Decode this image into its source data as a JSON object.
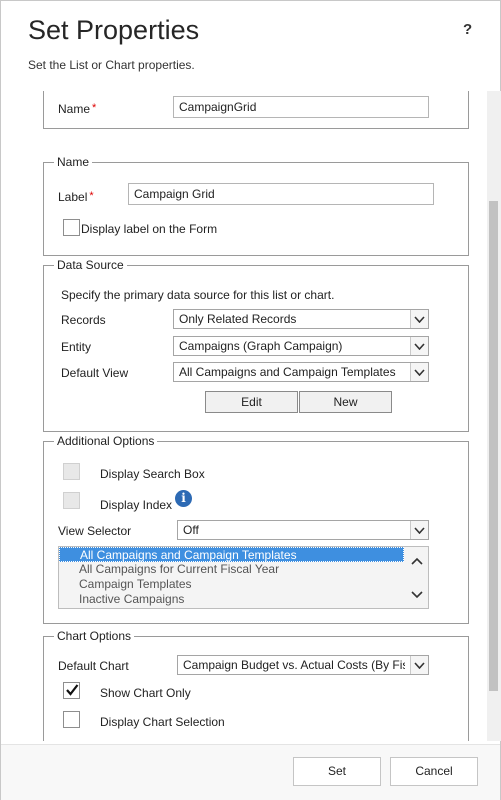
{
  "header": {
    "title": "Set Properties",
    "subtitle": "Set the List or Chart properties.",
    "help": "?"
  },
  "top_section": {
    "name_label": "Name",
    "name_value": "CampaignGrid"
  },
  "name_section": {
    "legend": "Name",
    "label_label": "Label",
    "label_value": "Campaign Grid",
    "display_label_text": "Display label on the Form"
  },
  "data_source": {
    "legend": "Data Source",
    "description": "Specify the primary data source for this list or chart.",
    "records_label": "Records",
    "records_value": "Only Related Records",
    "entity_label": "Entity",
    "entity_value": "Campaigns (Graph Campaign)",
    "default_view_label": "Default View",
    "default_view_value": "All Campaigns and Campaign Templates",
    "edit_button": "Edit",
    "new_button": "New"
  },
  "additional_options": {
    "legend": "Additional Options",
    "search_box_label": "Display Search Box",
    "index_label": "Display Index",
    "info_icon": "i",
    "view_selector_label": "View Selector",
    "view_selector_value": "Off",
    "views": [
      "All Campaigns and Campaign Templates",
      "All Campaigns for Current Fiscal Year",
      "Campaign Templates",
      "Inactive Campaigns"
    ]
  },
  "chart_options": {
    "legend": "Chart Options",
    "default_chart_label": "Default Chart",
    "default_chart_value": "Campaign Budget vs. Actual Costs (By Fisc",
    "show_chart_only_label": "Show Chart Only",
    "show_chart_only_checked": true,
    "display_chart_selection_label": "Display Chart Selection",
    "display_chart_selection_checked": false
  },
  "footer": {
    "set_button": "Set",
    "cancel_button": "Cancel"
  },
  "colors": {
    "required": "#d00000",
    "selected_item": "#3e8fe0",
    "info_icon": "#2d6ab4"
  }
}
